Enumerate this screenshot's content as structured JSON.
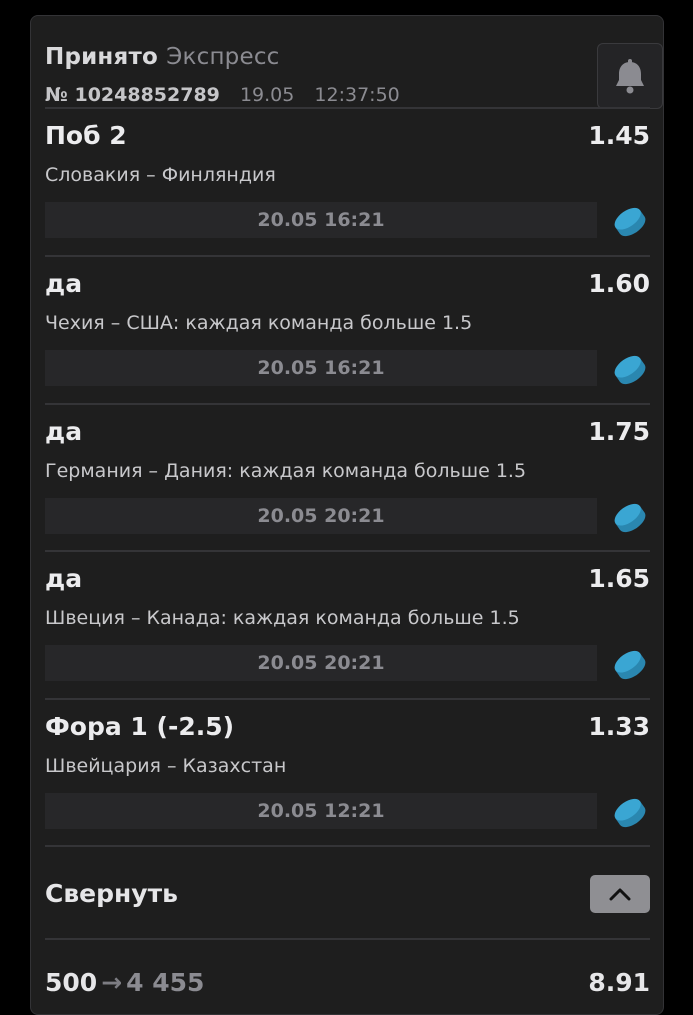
{
  "header": {
    "status": "Принято",
    "type": "Экспресс",
    "number": "№ 10248852789",
    "date": "19.05",
    "time": "12:37:50"
  },
  "bets": [
    {
      "name": "Поб 2",
      "odds": "1.45",
      "event": "Словакия – Финляндия",
      "datetime": "20.05 16:21",
      "icon": "hockey-puck-icon"
    },
    {
      "name": "да",
      "odds": "1.60",
      "event": "Чехия – США: каждая команда больше 1.5",
      "datetime": "20.05 16:21",
      "icon": "hockey-puck-icon"
    },
    {
      "name": "да",
      "odds": "1.75",
      "event": "Германия – Дания: каждая команда больше 1.5",
      "datetime": "20.05 20:21",
      "icon": "hockey-puck-icon"
    },
    {
      "name": "да",
      "odds": "1.65",
      "event": "Швеция – Канада: каждая команда больше 1.5",
      "datetime": "20.05 20:21",
      "icon": "hockey-puck-icon"
    },
    {
      "name": "Фора 1 (-2.5)",
      "odds": "1.33",
      "event": "Швейцария – Казахстан",
      "datetime": "20.05 12:21",
      "icon": "hockey-puck-icon"
    }
  ],
  "collapse": {
    "label": "Свернуть"
  },
  "summary": {
    "stake": "500",
    "arrow": "→",
    "potential_win": "4 455",
    "total_odds": "8.91"
  },
  "colors": {
    "accent_puck": "#3aa6d3",
    "background": "#1e1e1e"
  }
}
